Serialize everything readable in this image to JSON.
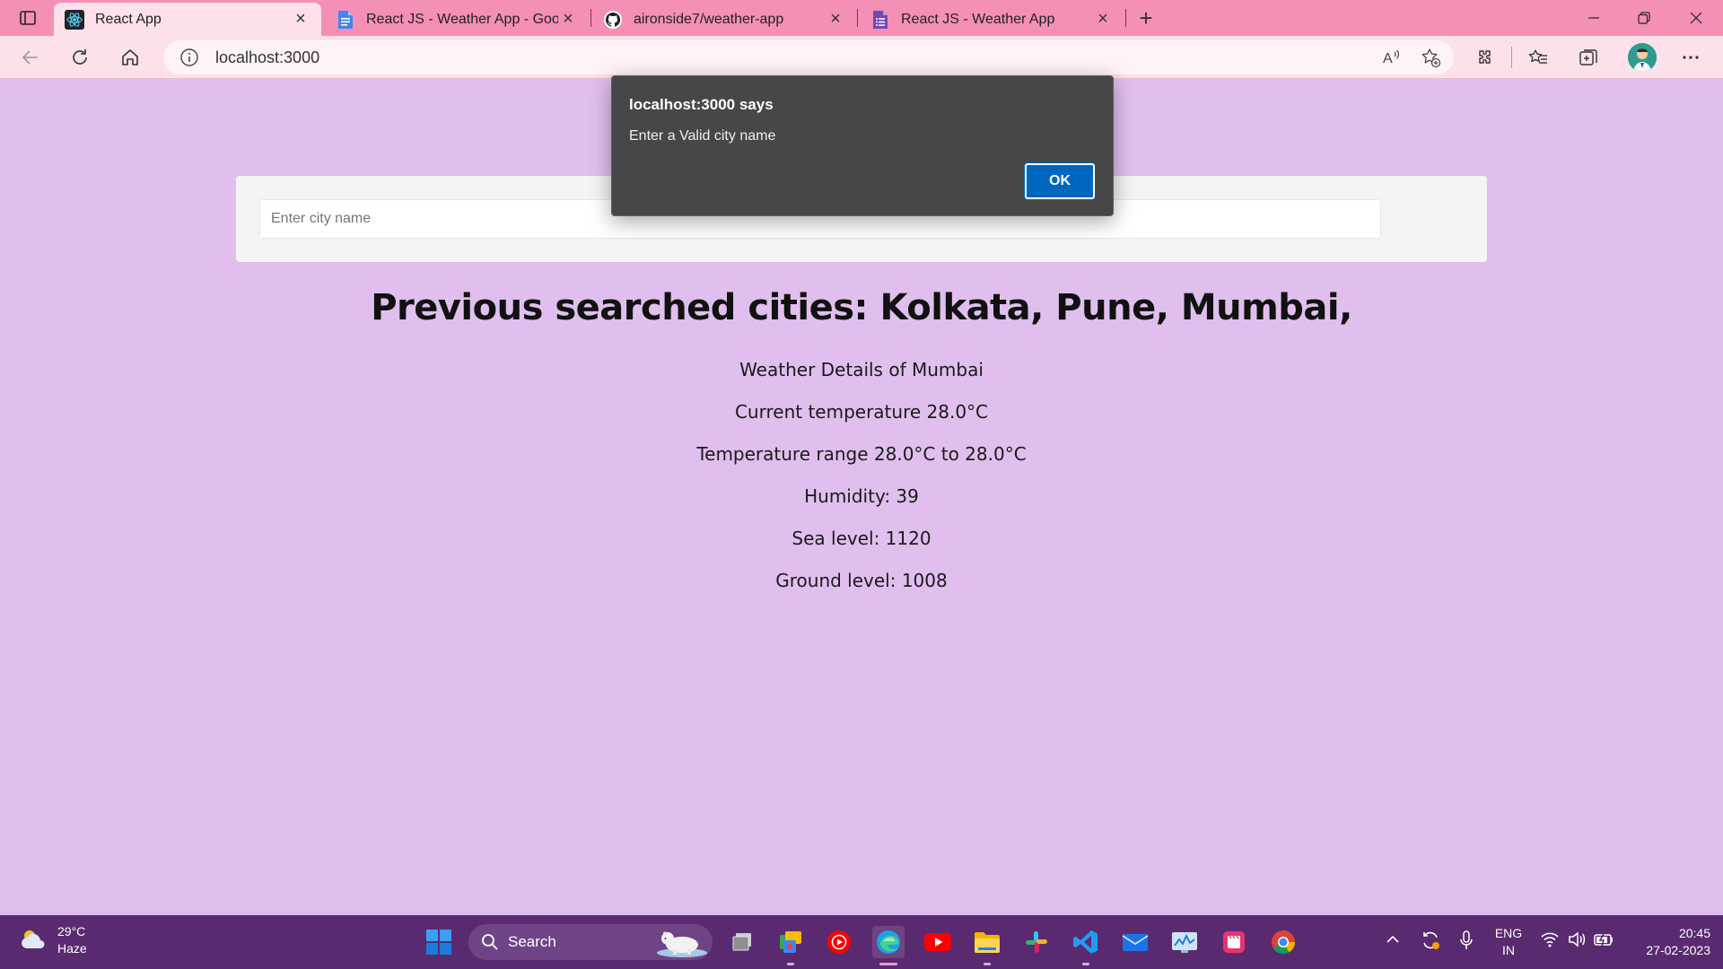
{
  "browser": {
    "tabs": [
      {
        "title": "React App",
        "active": true,
        "favicon": "react-icon"
      },
      {
        "title": "React JS - Weather App - Google",
        "active": false,
        "favicon": "google-docs-icon"
      },
      {
        "title": "aironside7/weather-app",
        "active": false,
        "favicon": "github-icon"
      },
      {
        "title": "React JS - Weather App",
        "active": false,
        "favicon": "google-forms-icon"
      }
    ],
    "address": "localhost:3000"
  },
  "page": {
    "search_placeholder": "Enter city name",
    "heading": "Previous searched cities: Kolkata, Pune, Mumbai,",
    "details": [
      "Weather Details of Mumbai",
      "Current temperature 28.0°C",
      "Temperature range 28.0°C to 28.0°C",
      "Humidity: 39",
      "Sea level: 1120",
      "Ground level: 1008"
    ]
  },
  "dialog": {
    "title": "localhost:3000 says",
    "message": "Enter a Valid city name",
    "ok_label": "OK"
  },
  "taskbar": {
    "weather_temp": "29°C",
    "weather_desc": "Haze",
    "search_label": "Search",
    "lang_top": "ENG",
    "lang_bottom": "IN",
    "time": "20:45",
    "date": "27-02-2023"
  },
  "colors": {
    "page_bg": "#e0bfee",
    "tabbar_bg": "#f48fb6",
    "toolbar_bg": "#fce1ea",
    "dialog_bg": "#474747",
    "ok_button": "#0067c0",
    "taskbar_bg": "#5a2a70"
  }
}
